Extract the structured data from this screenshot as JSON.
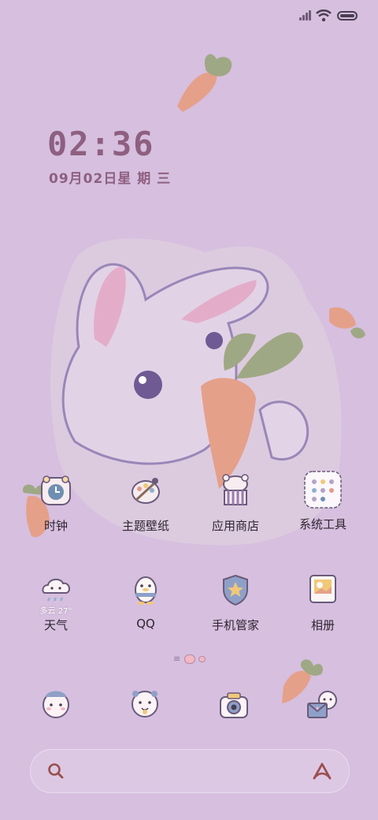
{
  "status_bar": {
    "icons": [
      "signal-icon",
      "wifi-icon",
      "battery-icon"
    ]
  },
  "clock": {
    "time": "02:36",
    "date": "09月02日星 期 三"
  },
  "apps_row1": [
    {
      "label": "时钟",
      "icon": "clock-icon"
    },
    {
      "label": "主题壁纸",
      "icon": "palette-icon"
    },
    {
      "label": "应用商店",
      "icon": "store-icon"
    },
    {
      "label": "系统工具",
      "icon": "folder-icon"
    }
  ],
  "apps_row2": [
    {
      "label": "天气",
      "icon": "weather-icon",
      "sub": "多云 27°"
    },
    {
      "label": "QQ",
      "icon": "penguin-icon"
    },
    {
      "label": "手机管家",
      "icon": "shield-icon"
    },
    {
      "label": "相册",
      "icon": "gallery-icon"
    }
  ],
  "dock": [
    "phone-bear-icon",
    "chat-bear-icon",
    "camera-icon",
    "mail-bear-icon"
  ],
  "search": {
    "icons": [
      "search-icon",
      "assistant-icon"
    ]
  },
  "colors": {
    "background": "#d6bfdf",
    "clock_text": "#8e5f80",
    "carrot": "#e5a08a",
    "leaf": "#9fa884"
  }
}
